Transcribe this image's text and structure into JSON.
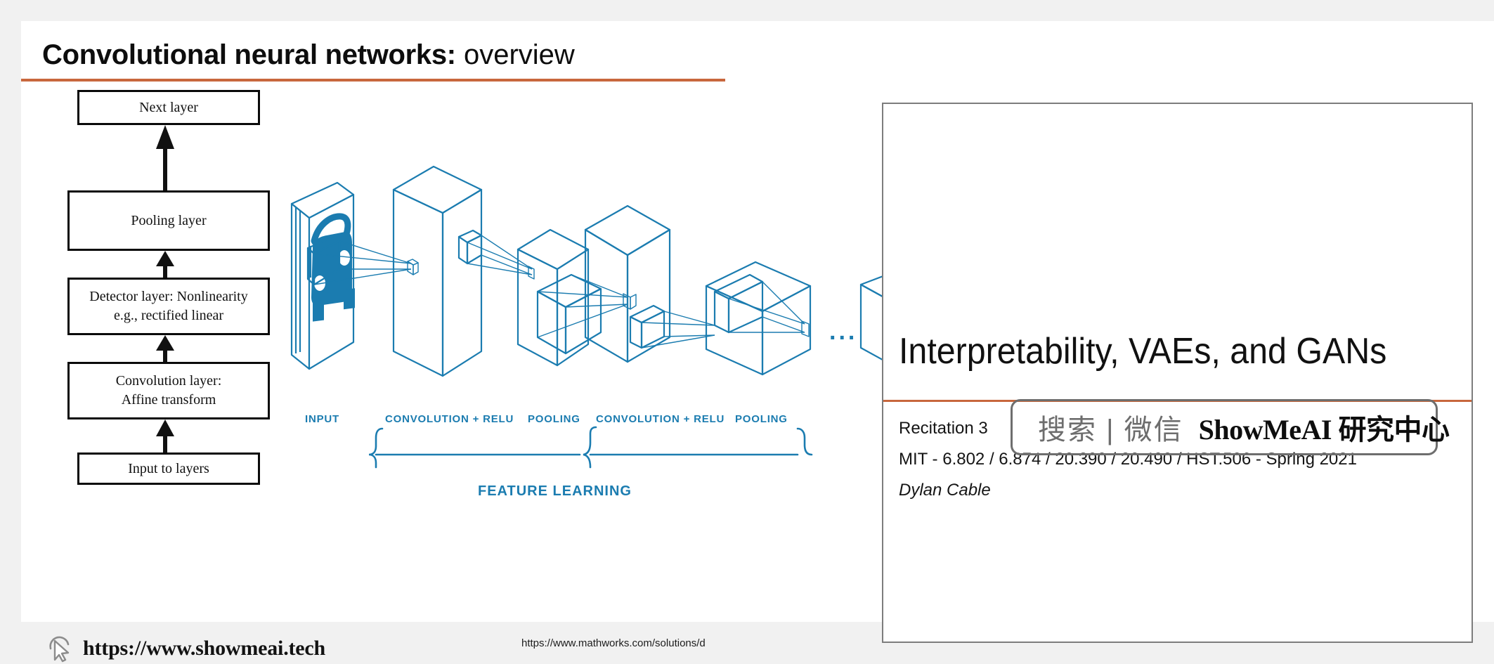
{
  "slide": {
    "title": {
      "strong": "Convolutional neural networks:",
      "light": " overview"
    },
    "accent_color": "#c8673d",
    "background": "#ffffff",
    "page_background": "#f1f1f1"
  },
  "stack_diagram": {
    "boxes": [
      {
        "label": "Next layer"
      },
      {
        "label": "Pooling layer"
      },
      {
        "label": "Detector layer: Nonlinearity",
        "label2": "e.g., rectified linear"
      },
      {
        "label": "Convolution layer:",
        "label2": "Affine transform"
      },
      {
        "label": "Input to layers"
      }
    ],
    "flow_direction": "bottom-to-top"
  },
  "cnn_illustration": {
    "accent_color": "#1b7cb0",
    "stage_labels": [
      "INPUT",
      "CONVOLUTION + RELU",
      "POOLING",
      "CONVOLUTION + RELU",
      "POOLING"
    ],
    "bracket_label": "FEATURE LEARNING",
    "ellipsis": "...",
    "source_url": "https://www.mathworks.com/solutions/d"
  },
  "watermark": {
    "url": "https://www.showmeai.tech",
    "cursor_icon": "cursor-icon"
  },
  "overlay": {
    "title": "Interpretability, VAEs, and GANs",
    "accent_color": "#c8673d",
    "lines": [
      {
        "text": "Recitation 3",
        "italic": false
      },
      {
        "text": "MIT - 6.802 / 6.874 / 20.390 / 20.490 / HST.506 - Spring 2021",
        "italic": false
      },
      {
        "text": "Dylan Cable",
        "italic": true
      }
    ],
    "search_watermark": {
      "icon": "search-icon",
      "cn_text": "搜索 | 微信",
      "brand": "ShowMeAI 研究中心"
    }
  }
}
